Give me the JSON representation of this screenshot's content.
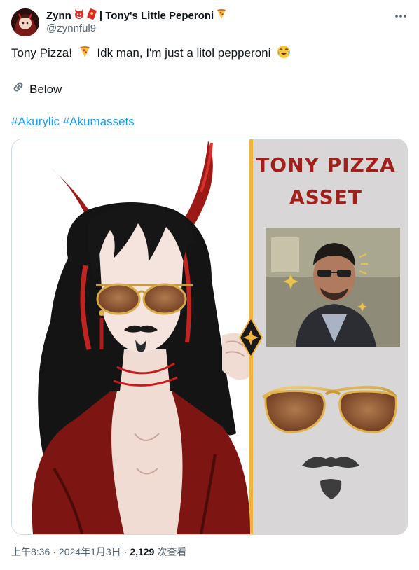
{
  "author": {
    "display_name": "Zynn",
    "name_suffix": "| Tony's Little Peperoni",
    "handle": "@zynnful9"
  },
  "post": {
    "line1_text": "Tony Pizza!",
    "line1_text_b": "Idk man, I'm just a litol pepperoni",
    "line2_text": "Below",
    "hashtags": [
      "#Akurylic",
      "#Akumassets"
    ]
  },
  "media": {
    "title_line1": "TONY PIZZA",
    "title_line2": "ASSET"
  },
  "meta": {
    "time": "上午8:36",
    "separator": "·",
    "date": "2024年1月3日",
    "views_count": "2,129",
    "views_label": "次查看"
  },
  "colors": {
    "link": "#1d9bf0",
    "secondary_text": "#536471",
    "title_red": "#a0211c",
    "divider_gold": "#f2b33a"
  },
  "icons": [
    "more-icon",
    "pizza-icon",
    "laughing-emoji-icon",
    "link-icon",
    "demon-emoji-icon",
    "red-envelope-icon"
  ]
}
